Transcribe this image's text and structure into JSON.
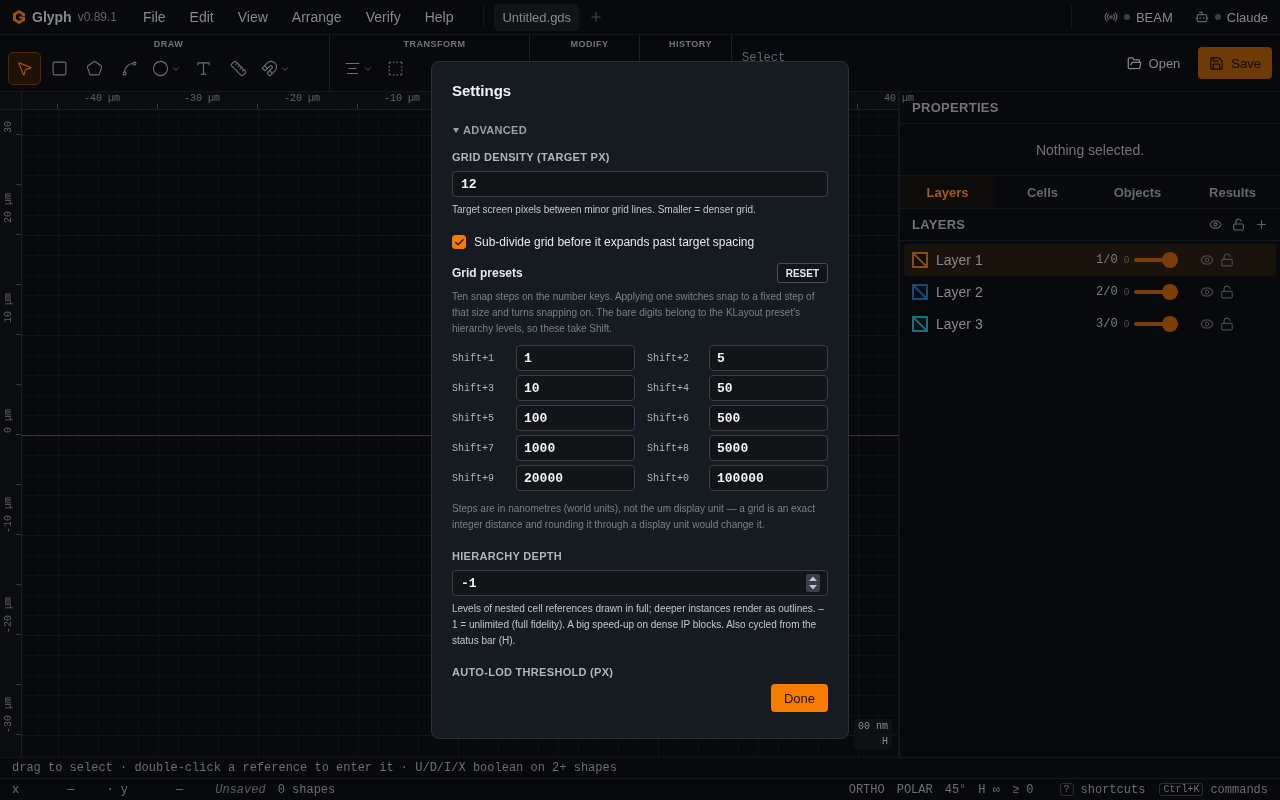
{
  "app": {
    "name": "Glyph",
    "version": "v0.89.1"
  },
  "menu": [
    "File",
    "Edit",
    "View",
    "Arrange",
    "Verify",
    "Help"
  ],
  "doc_tabs": [
    {
      "label": "Untitled.gds",
      "selected": true
    }
  ],
  "services": [
    {
      "kind": "broadcast",
      "label": "BEAM"
    },
    {
      "kind": "bot",
      "label": "Claude"
    }
  ],
  "toolbar": {
    "groups": [
      {
        "label": "DRAW",
        "tools": [
          {
            "kind": "pointer",
            "selected": true,
            "menu": false
          },
          {
            "kind": "rectangle",
            "selected": false,
            "menu": false
          },
          {
            "kind": "polygon",
            "selected": false,
            "menu": false
          },
          {
            "kind": "curve",
            "selected": false,
            "menu": false
          },
          {
            "kind": "circle",
            "selected": false,
            "menu": true
          },
          {
            "kind": "text",
            "selected": false,
            "menu": false
          },
          {
            "kind": "ruler",
            "selected": false,
            "menu": false
          },
          {
            "kind": "magnet",
            "selected": false,
            "menu": true
          }
        ]
      },
      {
        "label": "TRANSFORM",
        "tools": [
          {
            "kind": "align",
            "selected": false,
            "menu": true
          },
          {
            "kind": "frame",
            "selected": false,
            "menu": false
          }
        ]
      },
      {
        "label": "MODIFY"
      },
      {
        "label": "HISTORY"
      }
    ],
    "select_label": "Select",
    "open": "Open",
    "save": "Save"
  },
  "canvas": {
    "x_ticks": [
      "-40 µm",
      "-30 µm",
      "-20 µm",
      "-10 µm",
      "40 µm"
    ],
    "y_ticks": [
      "30",
      "20 µm",
      "10 µm",
      "0 µm",
      "-10 µm",
      "-20 µm",
      "-30 µm"
    ],
    "scale": "00 nm",
    "scale_mode": "H"
  },
  "properties": {
    "title": "PROPERTIES",
    "empty": "Nothing selected."
  },
  "panel_tabs": [
    {
      "label": "Layers",
      "selected": true
    },
    {
      "label": "Cells",
      "selected": false
    },
    {
      "label": "Objects",
      "selected": false
    },
    {
      "label": "Results",
      "selected": false
    }
  ],
  "layers": {
    "title": "LAYERS",
    "rows": [
      {
        "name": "Layer 1",
        "spec": "1/0",
        "count": "0",
        "color": "#8a4a14",
        "level": 1,
        "selected": true,
        "visible": true,
        "locked": false
      },
      {
        "name": "Layer 2",
        "spec": "2/0",
        "count": "0",
        "color": "#164a78",
        "level": 1,
        "selected": false,
        "visible": true,
        "locked": false
      },
      {
        "name": "Layer 3",
        "spec": "3/0",
        "count": "0",
        "color": "#16707e",
        "level": 1,
        "selected": false,
        "visible": true,
        "locked": false
      }
    ]
  },
  "settings": {
    "title": "Settings",
    "section": {
      "label": "ADVANCED",
      "expanded": true
    },
    "grid_density": {
      "label": "GRID DENSITY (TARGET PX)",
      "value": "12",
      "hint": "Target screen pixels between minor grid lines. Smaller = denser grid."
    },
    "subdivide": {
      "label": "Sub-divide grid before it expands past target spacing",
      "checked": true
    },
    "presets": {
      "title": "Grid presets",
      "reset": "RESET",
      "description": "Ten snap steps on the number keys. Applying one switches snap to a fixed step of that size and turns snapping on. The bare digits belong to the KLayout preset's hierarchy levels, so these take Shift.",
      "items": [
        {
          "key": "Shift+1",
          "value": "1"
        },
        {
          "key": "Shift+2",
          "value": "5"
        },
        {
          "key": "Shift+3",
          "value": "10"
        },
        {
          "key": "Shift+4",
          "value": "50"
        },
        {
          "key": "Shift+5",
          "value": "100"
        },
        {
          "key": "Shift+6",
          "value": "500"
        },
        {
          "key": "Shift+7",
          "value": "1000"
        },
        {
          "key": "Shift+8",
          "value": "5000"
        },
        {
          "key": "Shift+9",
          "value": "20000"
        },
        {
          "key": "Shift+0",
          "value": "100000"
        }
      ],
      "note": "Steps are in nanometres (world units), not the um display unit — a grid is an exact integer distance and rounding it through a display unit would change it."
    },
    "hierarchy": {
      "label": "HIERARCHY DEPTH",
      "value": "-1",
      "hint": "Levels of nested cell references drawn in full; deeper instances render as outlines. –1 = unlimited (full fidelity). A big speed-up on dense IP blocks. Also cycled from the status bar (H)."
    },
    "lod": {
      "label": "AUTO-LOD THRESHOLD (PX)"
    },
    "done": "Done"
  },
  "hint_bar": "drag to select · double-click a reference to enter it · U/D/I/X boolean on 2+ shapes",
  "status": {
    "cursor": [
      {
        "label": "x",
        "value": "—"
      },
      {
        "label": "· y",
        "value": "—"
      }
    ],
    "save_state": "Unsaved",
    "shapes": "0 shapes",
    "modes": [
      "ORTHO",
      "POLAR",
      "45°",
      "H ∞",
      "≥ 0"
    ],
    "keys": [
      {
        "key": "?",
        "label": "shortcuts"
      },
      {
        "key": "Ctrl+K",
        "label": "commands"
      }
    ]
  }
}
